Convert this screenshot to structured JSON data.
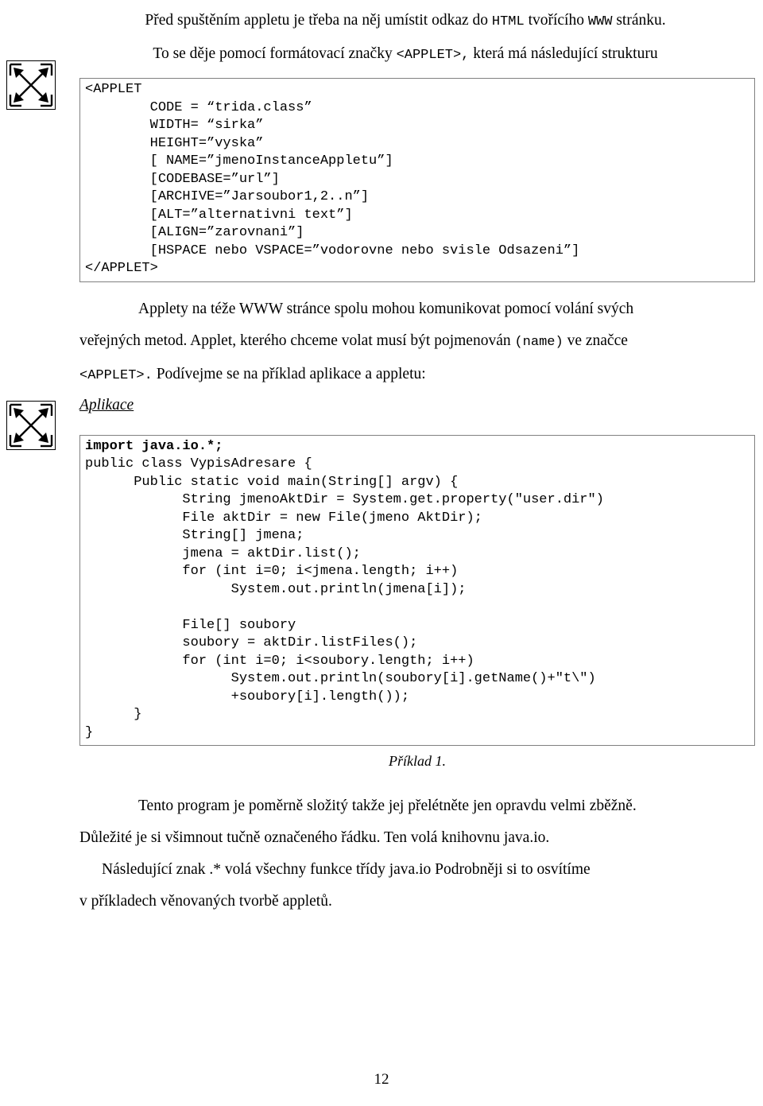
{
  "document": {
    "page_number": "12",
    "intro": {
      "line1_part1": "Před spuštěním appletu je třeba na něj umístit odkaz do ",
      "line1_mono1": "HTML",
      "line1_part2": " tvořícího ",
      "line1_mono2": "WWW",
      "line1_part3": " stránku.",
      "line2_part1": "To se děje pomocí formátovací značky ",
      "line2_mono": "<APPLET>,",
      "line2_part2": " která má následující strukturu"
    },
    "applet_code": "<APPLET\n        CODE = “trida.class”\n        WIDTH= “sirka”\n        HEIGHT=”vyska”\n        [ NAME=”jmenoInstanceAppletu”]\n        [CODEBASE=”url”]\n        [ARCHIVE=”Jarsoubor1,2..n”]\n        [ALT=”alternativni text”]\n        [ALIGN=”zarovnani”]\n        [HSPACE nebo VSPACE=”vodorovne nebo svisle Odsazeni”]\n</APPLET>",
    "middle": {
      "p1_part1": "Applety na téže WWW stránce spolu mohou komunikovat pomocí volání svých",
      "p2_part1": "veřejných metod. Applet, kterého chceme volat musí být pojmenován ",
      "p2_mono": "(name)",
      "p2_part2": " ve značce",
      "p3_mono": "<APPLET>.",
      "p3_part1": "  Podívejme se na příklad aplikace a appletu:",
      "section_title": "Aplikace"
    },
    "java_code_bold_line": "import java.io.*;",
    "java_code": "public class VypisAdresare {\n      Public static void main(String[] argv) {\n            String jmenoAktDir = System.get.property(\"user.dir\")\n            File aktDir = new File(jmeno AktDir);\n            String[] jmena;\n            jmena = aktDir.list();\n            for (int i=0; i<jmena.length; i++)\n                  System.out.println(jmena[i]);\n\n            File[] soubory\n            soubory = aktDir.listFiles();\n            for (int i=0; i<soubory.length; i++)\n                  System.out.println(soubory[i].getName()+\"t\\\")\n                  +soubory[i].length());\n      }\n}",
    "example_caption": "Příklad 1.",
    "closing": {
      "line1": "Tento program je poměrně složitý takže jej přelétněte jen opravdu velmi zběžně.",
      "line2": "Důležité je si všimnout tučně označeného řádku. Ten volá knihovnu java.io.",
      "line3": "Následující znak .* volá všechny funkce třídy java.io Podrobněji si to osvítíme",
      "line4": "v příkladech věnovaných tvorbě appletů."
    },
    "icons": {
      "figure_mark_1": "expand-arrows-icon",
      "figure_mark_2": "expand-arrows-icon"
    }
  }
}
